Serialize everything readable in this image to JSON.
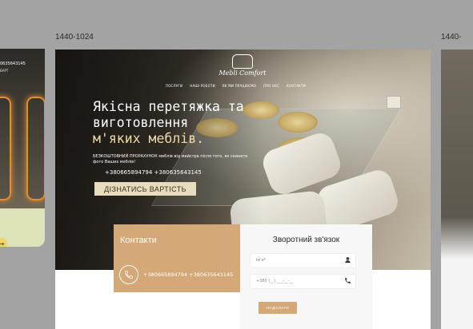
{
  "frames": {
    "center_label": "1440-1024",
    "right_label": "1440-"
  },
  "left_frame": {
    "top_text": "0635643145",
    "top_subtext": "ВАРТ"
  },
  "brand": {
    "name": "Mebli Comfort",
    "logo_icon": "sofa-icon"
  },
  "nav": {
    "items": [
      "ПОСЛУГИ",
      "НАШІ РОБОТИ",
      "ЯК МИ ПРАЦЮЄМО",
      "ПРО НАС",
      "КОНТАКТИ"
    ]
  },
  "hero": {
    "line1": "Якісна перетяжка та",
    "line2": "виготовлення",
    "line3": "м'яких меблів.",
    "subtitle": "БЕЗКОШТОВНИЙ ПРОРАХУНОК меблів від майстра після того, як скинете фото Ваших меблів!",
    "phones": "+380665894794 +380635643145",
    "cta": "ДІЗНАТИСЬ ВАРТІСТЬ"
  },
  "contacts": {
    "title": "Контакти",
    "phone_icon": "phone-icon",
    "numbers": "+380665894794 +380635643145"
  },
  "feedback": {
    "title": "Зворотний зв'язок",
    "name_placeholder": "Ім'я*",
    "phone_placeholder": "+380 (__) ___-__-__",
    "submit": "НАДІСЛАТИ"
  },
  "colors": {
    "accent": "#d4a877",
    "cta_bg": "#e7dcbd",
    "highlight_text": "#efd9a4",
    "canvas": "#a3a3a3"
  }
}
